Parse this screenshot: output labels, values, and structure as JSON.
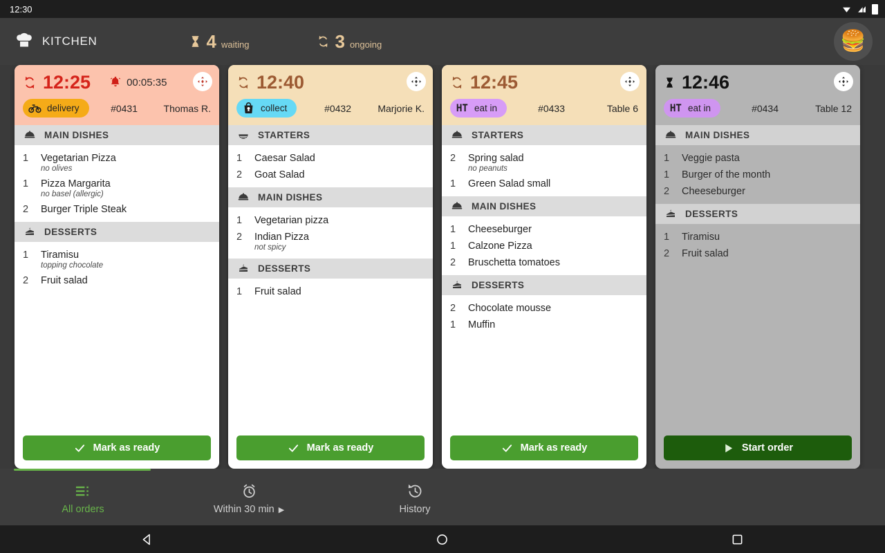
{
  "status_bar": {
    "time": "12:30",
    "icons": [
      "wifi-icon",
      "signal-icon",
      "battery-icon"
    ]
  },
  "header": {
    "logo_icon": "chef-hat-icon",
    "title": "KITCHEN",
    "waiting": {
      "icon": "hourglass-icon",
      "count": "4",
      "label": "waiting"
    },
    "ongoing": {
      "icon": "sync-icon",
      "count": "3",
      "label": "ongoing"
    },
    "avatar_icon": "burger-avatar-icon"
  },
  "orders": [
    {
      "state": "alert",
      "time": "12:25",
      "time_icon": "sync-icon",
      "alarm": {
        "icon": "alarm-bell-icon",
        "value": "00:05:35"
      },
      "grip_icon": "move-handle-icon",
      "type": {
        "icon": "motorbike-icon",
        "label": "delivery"
      },
      "order_no": "#0431",
      "customer": "Thomas R.",
      "sections": [
        {
          "icon": "food-dome-icon",
          "title": "MAIN DISHES",
          "items": [
            {
              "qty": "1",
              "name": "Vegetarian Pizza",
              "note": "no olives"
            },
            {
              "qty": "1",
              "name": "Pizza Margarita",
              "note": "no basel (allergic)"
            },
            {
              "qty": "2",
              "name": "Burger Triple Steak",
              "note": ""
            }
          ]
        },
        {
          "icon": "cake-slice-icon",
          "title": "DESSERTS",
          "items": [
            {
              "qty": "1",
              "name": "Tiramisu",
              "note": "topping chocolate"
            },
            {
              "qty": "2",
              "name": "Fruit salad",
              "note": ""
            }
          ]
        }
      ],
      "action": {
        "icon": "check-icon",
        "label": "Mark as ready",
        "style": "ready"
      }
    },
    {
      "state": "warm",
      "time": "12:40",
      "time_icon": "sync-icon",
      "alarm": null,
      "grip_icon": "move-handle-icon",
      "type": {
        "icon": "takeaway-bag-icon",
        "label": "collect"
      },
      "order_no": "#0432",
      "customer": "Marjorie K.",
      "sections": [
        {
          "icon": "bowl-icon",
          "title": "STARTERS",
          "items": [
            {
              "qty": "1",
              "name": "Caesar Salad",
              "note": ""
            },
            {
              "qty": "2",
              "name": "Goat Salad",
              "note": ""
            }
          ]
        },
        {
          "icon": "food-dome-icon",
          "title": "MAIN DISHES",
          "items": [
            {
              "qty": "1",
              "name": "Vegetarian pizza",
              "note": ""
            },
            {
              "qty": "2",
              "name": "Indian Pizza",
              "note": "not spicy"
            }
          ]
        },
        {
          "icon": "cake-slice-icon",
          "title": "DESSERTS",
          "items": [
            {
              "qty": "1",
              "name": "Fruit salad",
              "note": ""
            }
          ]
        }
      ],
      "action": {
        "icon": "check-icon",
        "label": "Mark as ready",
        "style": "ready"
      }
    },
    {
      "state": "warm",
      "time": "12:45",
      "time_icon": "sync-icon",
      "alarm": null,
      "grip_icon": "move-handle-icon",
      "type": {
        "icon": "eat-in-icon",
        "label": "eat in"
      },
      "order_no": "#0433",
      "customer": "Table 6",
      "sections": [
        {
          "icon": "food-dome-icon",
          "title": "STARTERS",
          "items": [
            {
              "qty": "2",
              "name": "Spring salad",
              "note": "no peanuts"
            },
            {
              "qty": "1",
              "name": "Green Salad small",
              "note": ""
            }
          ]
        },
        {
          "icon": "food-dome-icon",
          "title": "MAIN DISHES",
          "items": [
            {
              "qty": "1",
              "name": "Cheeseburger",
              "note": ""
            },
            {
              "qty": "1",
              "name": "Calzone Pizza",
              "note": ""
            },
            {
              "qty": "2",
              "name": "Bruschetta tomatoes",
              "note": ""
            }
          ]
        },
        {
          "icon": "cake-slice-icon",
          "title": "DESSERTS",
          "items": [
            {
              "qty": "2",
              "name": "Chocolate mousse",
              "note": ""
            },
            {
              "qty": "1",
              "name": "Muffin",
              "note": ""
            }
          ]
        }
      ],
      "action": {
        "icon": "check-icon",
        "label": "Mark as ready",
        "style": "ready"
      }
    },
    {
      "state": "pending",
      "time": "12:46",
      "time_icon": "hourglass-icon",
      "alarm": null,
      "grip_icon": "move-handle-icon",
      "type": {
        "icon": "eat-in-icon",
        "label": "eat in"
      },
      "order_no": "#0434",
      "customer": "Table 12",
      "sections": [
        {
          "icon": "food-dome-icon",
          "title": "MAIN DISHES",
          "items": [
            {
              "qty": "1",
              "name": "Veggie pasta",
              "note": ""
            },
            {
              "qty": "1",
              "name": "Burger of the month",
              "note": ""
            },
            {
              "qty": "2",
              "name": "Cheeseburger",
              "note": ""
            }
          ]
        },
        {
          "icon": "cake-slice-icon",
          "title": "DESSERTS",
          "items": [
            {
              "qty": "1",
              "name": "Tiramisu",
              "note": ""
            },
            {
              "qty": "2",
              "name": "Fruit salad",
              "note": ""
            }
          ]
        }
      ],
      "action": {
        "icon": "play-icon",
        "label": "Start order",
        "style": "start"
      }
    }
  ],
  "bottom_nav": [
    {
      "icon": "list-icon",
      "label": "All orders",
      "active": true,
      "chevron": false
    },
    {
      "icon": "alarm-clock-icon",
      "label": "Within 30 min",
      "active": false,
      "chevron": true
    },
    {
      "icon": "history-icon",
      "label": "History",
      "active": false,
      "chevron": false
    }
  ],
  "android_nav": {
    "back_icon": "back-triangle-icon",
    "home_icon": "home-circle-icon",
    "recents_icon": "recents-square-icon"
  },
  "colors": {
    "alert_header": "#fcc3ad",
    "warm_header": "#f5dfb8",
    "gray_header": "#b4b4b4",
    "alert_time": "#d5231a",
    "warm_time": "#9c5a33",
    "accent_green": "#4a9e2f",
    "start_green": "#1d5c0c",
    "delivery_badge": "#f5ab18",
    "collect_badge": "#66d9f5",
    "eatin_badge": "#d79cf7",
    "app_bg": "#3a3a3a",
    "stat_gold": "#e7c89a"
  }
}
